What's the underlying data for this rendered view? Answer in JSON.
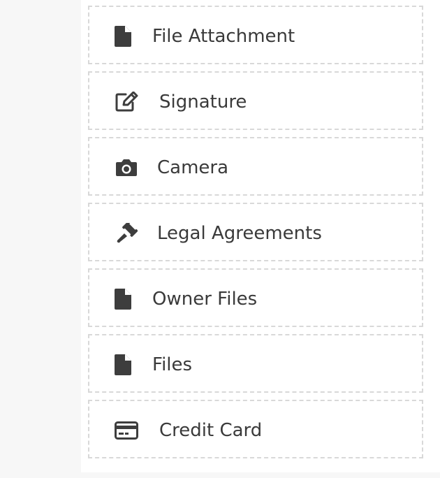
{
  "fields": [
    {
      "label": "File Attachment",
      "icon": "file-icon"
    },
    {
      "label": "Signature",
      "icon": "edit-icon"
    },
    {
      "label": "Camera",
      "icon": "camera-icon"
    },
    {
      "label": "Legal Agreements",
      "icon": "gavel-icon"
    },
    {
      "label": "Owner Files",
      "icon": "file-icon"
    },
    {
      "label": "Files",
      "icon": "file-icon"
    },
    {
      "label": "Credit Card",
      "icon": "credit-card-icon"
    }
  ],
  "colors": {
    "text": "#3a3a3a",
    "icon": "#3d3d3d",
    "border": "#d8d8d8",
    "background": "#f7f7f7",
    "panel": "#ffffff"
  }
}
